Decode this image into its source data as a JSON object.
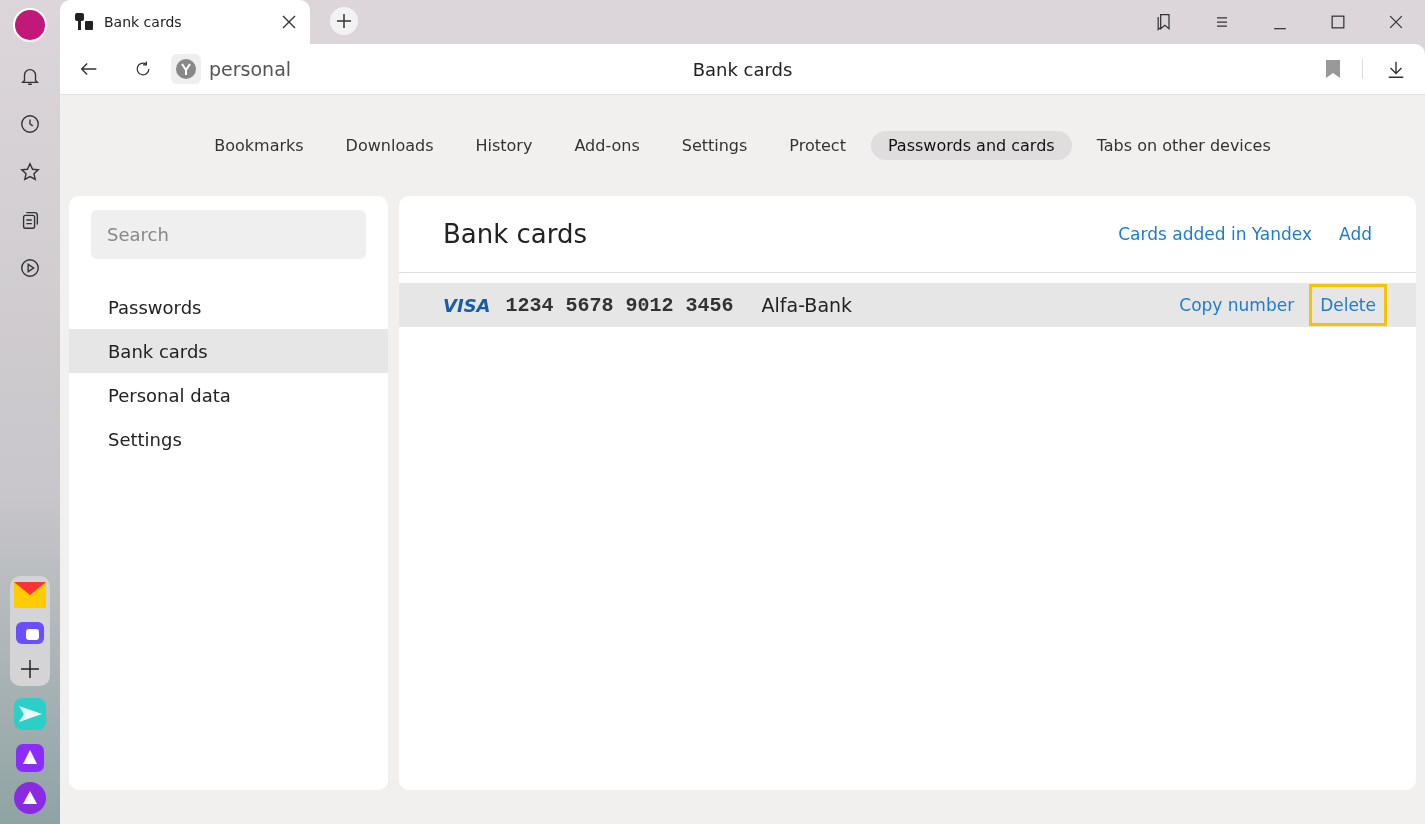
{
  "tab": {
    "title": "Bank cards"
  },
  "address_bar": {
    "site": "personal",
    "page_title": "Bank cards"
  },
  "nav": [
    {
      "label": "Bookmarks",
      "selected": false
    },
    {
      "label": "Downloads",
      "selected": false
    },
    {
      "label": "History",
      "selected": false
    },
    {
      "label": "Add-ons",
      "selected": false
    },
    {
      "label": "Settings",
      "selected": false
    },
    {
      "label": "Protect",
      "selected": false
    },
    {
      "label": "Passwords and cards",
      "selected": true
    },
    {
      "label": "Tabs on other devices",
      "selected": false
    }
  ],
  "sidebar": {
    "search_placeholder": "Search",
    "items": [
      {
        "label": "Passwords",
        "selected": false
      },
      {
        "label": "Bank cards",
        "selected": true
      },
      {
        "label": "Personal data",
        "selected": false
      },
      {
        "label": "Settings",
        "selected": false
      }
    ]
  },
  "main": {
    "title": "Bank cards",
    "links": [
      "Cards added in Yandex",
      "Add"
    ],
    "cards": [
      {
        "brand": "VISA",
        "number": "1234 5678 9012 3456",
        "bank": "Alfa-Bank",
        "actions": [
          {
            "label": "Copy number",
            "focused": false
          },
          {
            "label": "Delete",
            "focused": true
          }
        ]
      }
    ]
  }
}
